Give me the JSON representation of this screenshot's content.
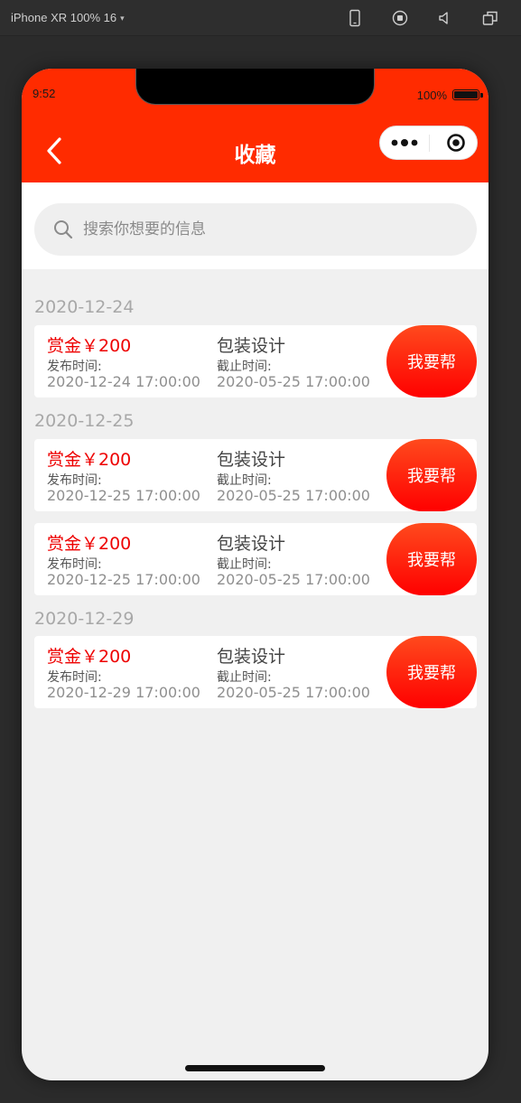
{
  "devtools": {
    "device_label": "iPhone XR 100% 16",
    "dropdown_caret": "▾",
    "icons": [
      "phone-icon",
      "record-icon",
      "volume-icon",
      "window-icon"
    ]
  },
  "status_bar": {
    "time": "9:52",
    "battery": "100%"
  },
  "nav": {
    "title": "收藏",
    "back_icon": "back-arrow-icon",
    "more_icon": "more-dots-icon",
    "close_icon": "target-close-icon",
    "color": "#ff2b00"
  },
  "search": {
    "placeholder": "搜索你想要的信息",
    "value": ""
  },
  "groups": [
    {
      "date": "2020-12-24",
      "items": [
        {
          "reward": "赏金￥200",
          "publish_label": "发布时间:",
          "publish_time": "2020-12-24 17:00:00",
          "category": "包装设计",
          "deadline_label": "截止时间:",
          "deadline_time": "2020-05-25 17:00:00",
          "action": "我要帮"
        }
      ]
    },
    {
      "date": "2020-12-25",
      "items": [
        {
          "reward": "赏金￥200",
          "publish_label": "发布时间:",
          "publish_time": "2020-12-25 17:00:00",
          "category": "包装设计",
          "deadline_label": "截止时间:",
          "deadline_time": "2020-05-25 17:00:00",
          "action": "我要帮"
        },
        {
          "reward": "赏金￥200",
          "publish_label": "发布时间:",
          "publish_time": "2020-12-25 17:00:00",
          "category": "包装设计",
          "deadline_label": "截止时间:",
          "deadline_time": "2020-05-25 17:00:00",
          "action": "我要帮"
        }
      ]
    },
    {
      "date": "2020-12-29",
      "items": [
        {
          "reward": "赏金￥200",
          "publish_label": "发布时间:",
          "publish_time": "2020-12-29 17:00:00",
          "category": "包装设计",
          "deadline_label": "截止时间:",
          "deadline_time": "2020-05-25 17:00:00",
          "action": "我要帮"
        }
      ]
    }
  ],
  "colors": {
    "reward": "#ee0000",
    "button_gradient_top": "#ff4a1d",
    "button_gradient_bottom": "#ff0000",
    "page_bg": "#f0f0f0"
  }
}
